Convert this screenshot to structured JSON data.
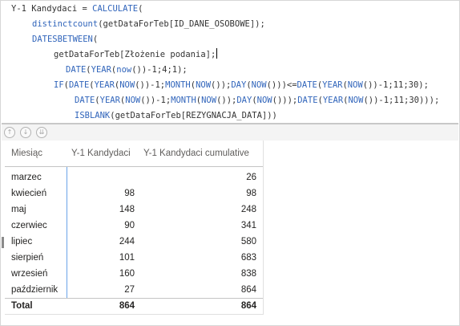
{
  "editor": {
    "lines": [
      {
        "parts": [
          {
            "t": "Y-1 Kandydaci = ",
            "k": false
          },
          {
            "t": "CALCULATE",
            "k": true
          },
          {
            "t": "(",
            "k": false
          }
        ]
      },
      {
        "parts": [
          {
            "t": "distinctcount",
            "k": true
          },
          {
            "t": "(getDataForTeb[ID_DANE_OSOBOWE]);",
            "k": false
          }
        ]
      },
      {
        "parts": [
          {
            "t": "DATESBETWEEN",
            "k": true
          },
          {
            "t": "(",
            "k": false
          }
        ]
      },
      {
        "parts": [
          {
            "t": "getDataForTeb[Złożenie podania];",
            "k": false
          }
        ],
        "caret": true
      },
      {
        "parts": [
          {
            "t": "DATE",
            "k": true
          },
          {
            "t": "(",
            "k": false
          },
          {
            "t": "YEAR",
            "k": true
          },
          {
            "t": "(",
            "k": false
          },
          {
            "t": "now",
            "k": true
          },
          {
            "t": "())-1;4;1);",
            "k": false
          }
        ]
      },
      {
        "parts": [
          {
            "t": "IF",
            "k": true
          },
          {
            "t": "(",
            "k": false
          },
          {
            "t": "DATE",
            "k": true
          },
          {
            "t": "(",
            "k": false
          },
          {
            "t": "YEAR",
            "k": true
          },
          {
            "t": "(",
            "k": false
          },
          {
            "t": "NOW",
            "k": true
          },
          {
            "t": "())-1;",
            "k": false
          },
          {
            "t": "MONTH",
            "k": true
          },
          {
            "t": "(",
            "k": false
          },
          {
            "t": "NOW",
            "k": true
          },
          {
            "t": "());",
            "k": false
          },
          {
            "t": "DAY",
            "k": true
          },
          {
            "t": "(",
            "k": false
          },
          {
            "t": "NOW",
            "k": true
          },
          {
            "t": "()))<=",
            "k": false
          },
          {
            "t": "DATE",
            "k": true
          },
          {
            "t": "(",
            "k": false
          },
          {
            "t": "YEAR",
            "k": true
          },
          {
            "t": "(",
            "k": false
          },
          {
            "t": "NOW",
            "k": true
          },
          {
            "t": "())-1;11;30);",
            "k": false
          }
        ]
      },
      {
        "parts": [
          {
            "t": "DATE",
            "k": true
          },
          {
            "t": "(",
            "k": false
          },
          {
            "t": "YEAR",
            "k": true
          },
          {
            "t": "(",
            "k": false
          },
          {
            "t": "NOW",
            "k": true
          },
          {
            "t": "())-1;",
            "k": false
          },
          {
            "t": "MONTH",
            "k": true
          },
          {
            "t": "(",
            "k": false
          },
          {
            "t": "NOW",
            "k": true
          },
          {
            "t": "());",
            "k": false
          },
          {
            "t": "DAY",
            "k": true
          },
          {
            "t": "(",
            "k": false
          },
          {
            "t": "NOW",
            "k": true
          },
          {
            "t": "()));",
            "k": false
          },
          {
            "t": "DATE",
            "k": true
          },
          {
            "t": "(",
            "k": false
          },
          {
            "t": "YEAR",
            "k": true
          },
          {
            "t": "(",
            "k": false
          },
          {
            "t": "NOW",
            "k": true
          },
          {
            "t": "())-1;11;30)));",
            "k": false
          }
        ]
      },
      {
        "parts": [
          {
            "t": "ISBLANK",
            "k": true
          },
          {
            "t": "(getDataForTeb[REZYGNACJA_DATA]))",
            "k": false
          }
        ]
      }
    ]
  },
  "toolbar": {
    "icons": [
      "drill-up-icon",
      "drill-down-icon",
      "expand-all-icon"
    ]
  },
  "table": {
    "headers": {
      "month": "Miesiąc",
      "value": "Y-1 Kandydaci",
      "cumulative": "Y-1 Kandydaci cumulative"
    },
    "rows": [
      {
        "month": "marzec",
        "value": "",
        "cumulative": "26"
      },
      {
        "month": "kwiecień",
        "value": "98",
        "cumulative": "98"
      },
      {
        "month": "maj",
        "value": "148",
        "cumulative": "248"
      },
      {
        "month": "czerwiec",
        "value": "90",
        "cumulative": "341"
      },
      {
        "month": "lipiec",
        "value": "244",
        "cumulative": "580"
      },
      {
        "month": "sierpień",
        "value": "101",
        "cumulative": "683"
      },
      {
        "month": "wrzesień",
        "value": "160",
        "cumulative": "838"
      },
      {
        "month": "październik",
        "value": "27",
        "cumulative": "864"
      }
    ],
    "total": {
      "month": "Total",
      "value": "864",
      "cumulative": "864"
    }
  },
  "colors": {
    "keyword": "#3165bb",
    "text": "#333333",
    "selected_column_rule": "#6aa3e8"
  }
}
